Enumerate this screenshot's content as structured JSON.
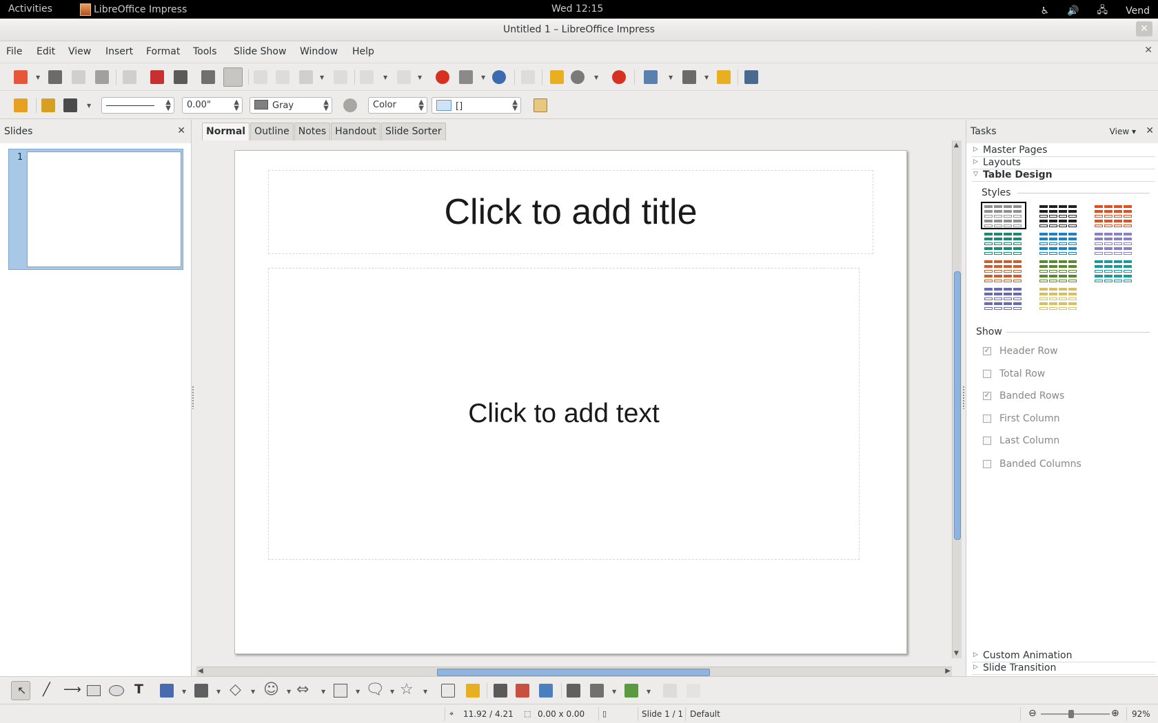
{
  "topbar": {
    "activities": "Activities",
    "app_name": "LibreOffice Impress",
    "clock": "Wed 12:15",
    "user": "Vend"
  },
  "window": {
    "title": "Untitled 1 – LibreOffice Impress"
  },
  "menu": [
    "File",
    "Edit",
    "View",
    "Insert",
    "Format",
    "Tools",
    "Slide Show",
    "Window",
    "Help"
  ],
  "toolbar2": {
    "line_width": "0.00\"",
    "line_color": "Gray",
    "line_color_hex": "#808080",
    "area_style": "Color",
    "area_color_value": "[]",
    "area_color_hex": "#cfe3f5"
  },
  "slides_pane": {
    "title": "Slides",
    "slide_number": "1"
  },
  "view_tabs": [
    "Normal",
    "Outline",
    "Notes",
    "Handout",
    "Slide Sorter"
  ],
  "slide": {
    "title_placeholder": "Click to add title",
    "body_placeholder": "Click to add text"
  },
  "tasks": {
    "title": "Tasks",
    "view_label": "View",
    "sections_top": [
      "Master Pages",
      "Layouts",
      "Table Design"
    ],
    "styles_label": "Styles",
    "show_label": "Show",
    "options": [
      {
        "label": "Header Row",
        "checked": true
      },
      {
        "label": "Total Row",
        "checked": false
      },
      {
        "label": "Banded Rows",
        "checked": true
      },
      {
        "label": "First Column",
        "checked": false
      },
      {
        "label": "Last Column",
        "checked": false
      },
      {
        "label": "Banded Columns",
        "checked": false
      }
    ],
    "sections_bottom": [
      "Custom Animation",
      "Slide Transition"
    ],
    "style_colors": [
      "#909090",
      "#202020",
      "#e05020",
      "#1a8a70",
      "#1a80c8",
      "#8a80c8",
      "#c86030",
      "#5a8a30",
      "#1a9a9a",
      "#6a6ab0",
      "#d8c060"
    ]
  },
  "status": {
    "position": "11.92 / 4.21",
    "size": "0.00 x 0.00",
    "slide": "Slide 1 / 1",
    "master": "Default",
    "zoom": "92%"
  }
}
